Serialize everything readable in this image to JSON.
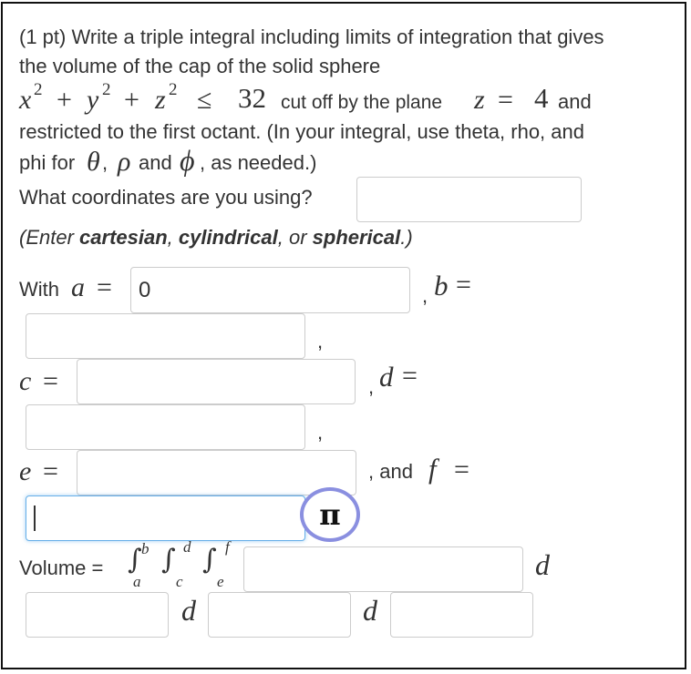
{
  "problem": {
    "line1": "(1 pt) Write a triple integral including limits of integration that gives",
    "line2": "the volume of the cap of the solid sphere",
    "math_x": "x",
    "math_y": "y",
    "math_z": "z",
    "exp2": "2",
    "plus": "+",
    "leq": "≤",
    "num32": "32",
    "cutoff": "cut off by the plane",
    "eq": "=",
    "num4": "4",
    "and": "and",
    "line4": "restricted to the first octant. (In your integral, use theta, rho, and",
    "phi_for": "phi for",
    "theta_sym": "θ",
    "comma": ",",
    "rho_sym": "ρ",
    "and2": "and",
    "phi_sym": "ϕ",
    "as_needed": ", as needed.)"
  },
  "coords": {
    "question": "What coordinates are you using?",
    "hint_open": "(Enter ",
    "opt1": "cartesian",
    "sep1": ", ",
    "opt2": "cylindrical",
    "sep2": ", or ",
    "opt3": "spherical",
    "hint_close": ".)",
    "value": ""
  },
  "limits": {
    "with": "With",
    "a_sym": "a",
    "a_value": "0",
    "b_sym": "b",
    "b_value": "",
    "c_sym": "c",
    "c_value": "",
    "d_sym": "d",
    "d_value": "",
    "e_sym": "e",
    "e_value": "",
    "f_sym": "f",
    "f_value": "",
    "eq": "=",
    "comma": ",",
    "and_label": ", and"
  },
  "pi_button": "π",
  "volume": {
    "label": "Volume =",
    "integral": "∫",
    "upper1": "b",
    "lower1": "a",
    "upper2": "d",
    "lower2": "c",
    "upper3": "f",
    "lower3": "e",
    "integrand_value": "",
    "d1": "d",
    "diff1_value": "",
    "d2": "d",
    "diff2_value": "",
    "d3": "d",
    "diff3_value": ""
  }
}
